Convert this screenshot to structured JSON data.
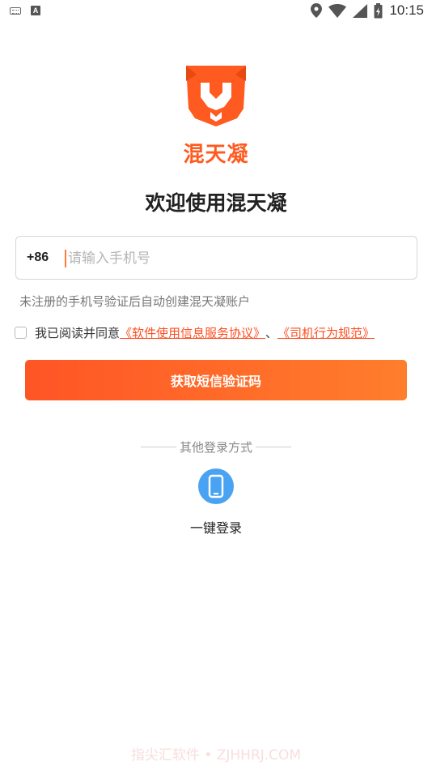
{
  "status_bar": {
    "left_icons": [
      "keyboard-icon",
      "a-app-icon"
    ],
    "right_icons": [
      "location-icon",
      "wifi-icon",
      "signal-icon",
      "battery-icon"
    ],
    "time": "10:15",
    "a_icon_glyph": "A"
  },
  "brand": {
    "name": "混天凝",
    "accent_color": "#ff5a1f"
  },
  "welcome_title": "欢迎使用混天凝",
  "phone_input": {
    "country_code": "+86",
    "value": "",
    "placeholder": "请输入手机号"
  },
  "register_hint": "未注册的手机号验证后自动创建混天凝账户",
  "agreement": {
    "prefix": "我已阅读并同意",
    "link_1": "《软件使用信息服务协议》",
    "separator": "、",
    "link_2": "《司机行为规范》",
    "checked": false
  },
  "primary_button": {
    "label": "获取短信验证码"
  },
  "other_login": {
    "heading": "其他登录方式",
    "one_key_label": "一键登录",
    "icon": "phone-icon",
    "icon_color": "#4aa3f2"
  },
  "watermark": "指尖汇软件 • ZJHHRJ.COM"
}
